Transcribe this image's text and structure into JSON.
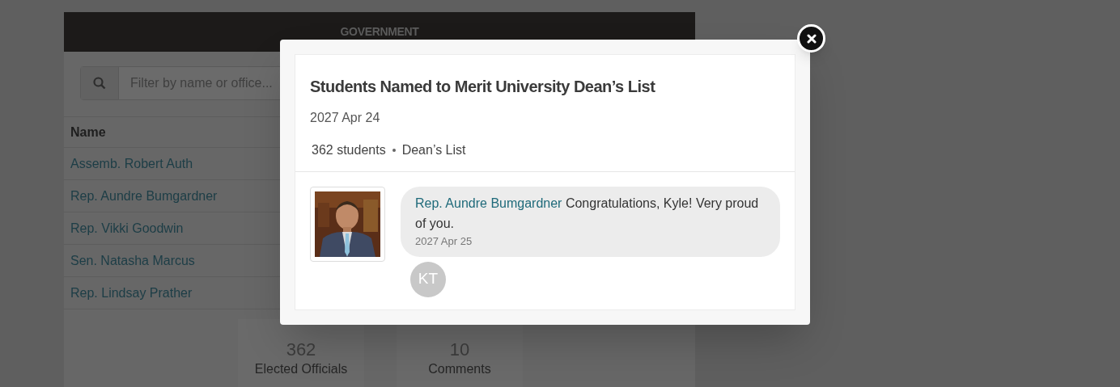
{
  "page": {
    "header": "GOVERNMENT",
    "search": {
      "placeholder": "Filter by name or office..."
    },
    "table": {
      "columns": [
        "Name"
      ],
      "rows": [
        "Assemb. Robert Auth",
        "Rep. Aundre Bumgardner",
        "Rep. Vikki Goodwin",
        "Sen. Natasha Marcus",
        "Rep. Lindsay Prather"
      ]
    },
    "stats": [
      {
        "value": "362",
        "label": "Elected Officials"
      },
      {
        "value": "10",
        "label": "Comments"
      }
    ]
  },
  "modal": {
    "title": "Students Named to Merit University Dean’s List",
    "date": "2027 Apr 24",
    "meta": [
      "362 students",
      "Dean’s List"
    ],
    "comment": {
      "author": "Rep. Aundre Bumgardner",
      "text": "Congratulations, Kyle! Very proud of you.",
      "date": "2027 Apr 25"
    },
    "avatar": "KT"
  }
}
